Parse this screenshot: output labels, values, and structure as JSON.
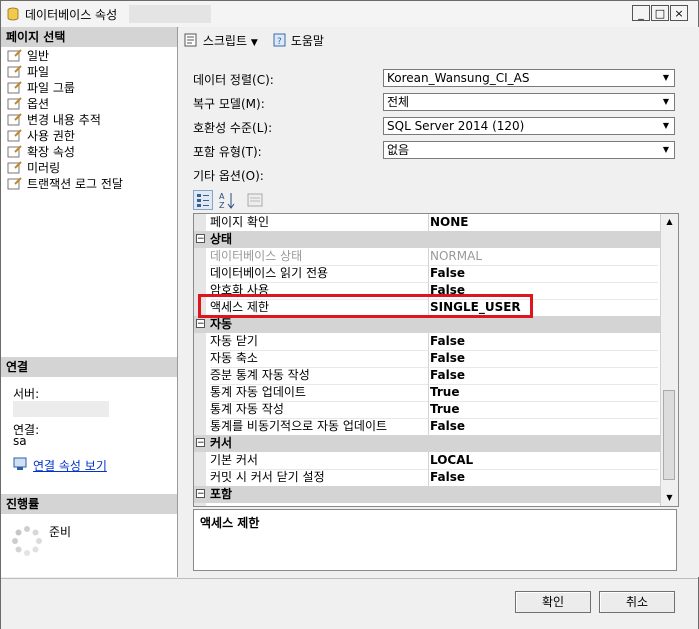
{
  "window": {
    "title": "데이터베이스 속성",
    "controls": [
      "_",
      "□",
      "×"
    ]
  },
  "left_panel": {
    "page_select_header": "페이지 선택",
    "pages": [
      "일반",
      "파일",
      "파일 그룹",
      "옵션",
      "변경 내용 추적",
      "사용 권한",
      "확장 속성",
      "미러링",
      "트랜잭션 로그 전달"
    ],
    "connection_header": "연결",
    "server_label": "서버:",
    "connection_label": "연결:",
    "connection_value": "sa",
    "view_connection_link": "연결 속성 보기",
    "progress_header": "진행률",
    "progress_status": "준비"
  },
  "toolbar": {
    "script_label": "스크립트",
    "help_label": "도움말"
  },
  "form": {
    "collation_label": "데이터 정렬(C):",
    "collation_value": "Korean_Wansung_CI_AS",
    "recovery_label": "복구 모델(M):",
    "recovery_value": "전체",
    "compat_label": "호환성 수준(L):",
    "compat_value": "SQL Server 2014 (120)",
    "containment_label": "포함 유형(T):",
    "containment_value": "없음",
    "other_options_label": "기타 옵션(O):"
  },
  "grid": {
    "page_verify": {
      "name": "페이지 확인",
      "value": "NONE"
    },
    "cat_state": "상태",
    "db_state": {
      "name": "데이터베이스 상태",
      "value": "NORMAL"
    },
    "db_readonly": {
      "name": "데이터베이스 읽기 전용",
      "value": "False"
    },
    "encryption": {
      "name": "암호화 사용",
      "value": "False"
    },
    "restrict_access": {
      "name": "액세스 제한",
      "value": "SINGLE_USER"
    },
    "cat_auto": "자동",
    "auto_close": {
      "name": "자동 닫기",
      "value": "False"
    },
    "auto_shrink": {
      "name": "자동 축소",
      "value": "False"
    },
    "auto_incr_stats": {
      "name": "증분 통계 자동 작성",
      "value": "False"
    },
    "auto_update_stats": {
      "name": "통계 자동 업데이트",
      "value": "True"
    },
    "auto_create_stats": {
      "name": "통계 자동 작성",
      "value": "True"
    },
    "auto_update_stats_async": {
      "name": "통계를 비동기적으로 자동 업데이트",
      "value": "False"
    },
    "cat_cursor": "커서",
    "default_cursor": {
      "name": "기본 커서",
      "value": "LOCAL"
    },
    "close_cursor_commit": {
      "name": "커밋 시 커서 닫기 설정",
      "value": "False"
    },
    "cat_containment": "포함"
  },
  "description": "액세스 제한",
  "buttons": {
    "ok": "확인",
    "cancel": "취소"
  },
  "colors": {
    "highlight_border": "#e0141e",
    "link": "#0033cc",
    "section_header": "#d4d4d4"
  }
}
